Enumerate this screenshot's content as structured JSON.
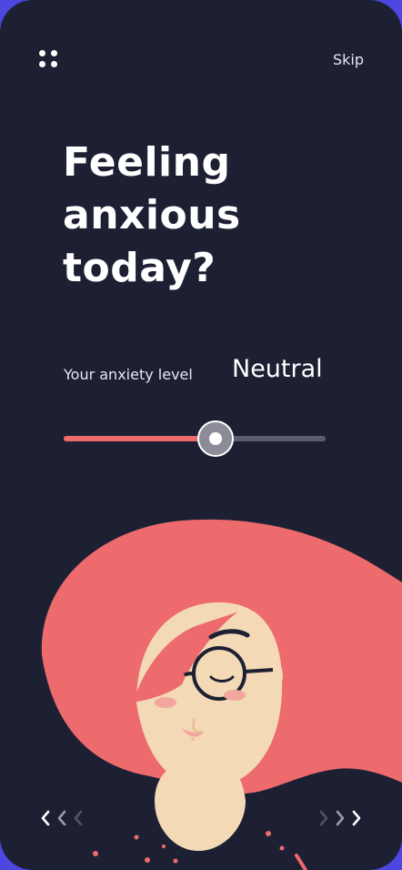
{
  "header": {
    "skip_label": "Skip",
    "menu_icon": "grid-dots-icon"
  },
  "hero": {
    "title_lines": [
      "Feeling",
      "anxious",
      "today?"
    ]
  },
  "anxiety": {
    "label": "Your anxiety level",
    "value_label": "Neutral",
    "level_fraction": 0.58
  },
  "illustration": {
    "subject": "woman-with-glasses-illustration"
  },
  "navigation": {
    "prev_icon": "chevrons-left-icon",
    "next_icon": "chevrons-right-icon"
  },
  "colors": {
    "background": "#1d2033",
    "frame": "#4b47e0",
    "accent": "#ed6b6d",
    "skin": "#f3d9b5"
  }
}
